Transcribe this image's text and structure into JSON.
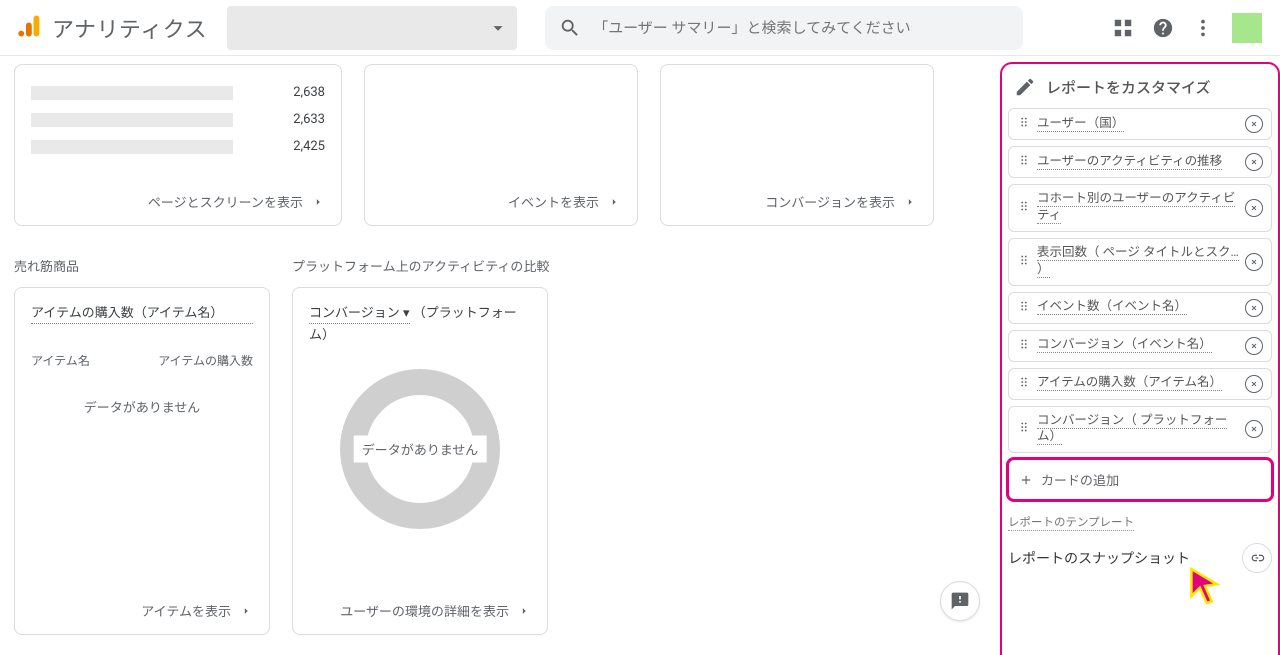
{
  "header": {
    "product": "アナリティクス",
    "search_placeholder": "「ユーザー サマリー」と検索してみてください"
  },
  "cards_row1": {
    "pages": {
      "values": [
        "2,638",
        "2,633",
        "2,425"
      ],
      "link": "ページとスクリーンを表示"
    },
    "events": {
      "link": "イベントを表示"
    },
    "conversions": {
      "link": "コンバージョンを表示"
    }
  },
  "section_left": {
    "title": "売れ筋商品",
    "metric": "アイテムの購入数（アイテム名）",
    "col_a": "アイテム名",
    "col_b": "アイテムの購入数",
    "nodata": "データがありません",
    "link": "アイテムを表示"
  },
  "section_right": {
    "title": "プラットフォーム上のアクティビティの比較",
    "metric_a": "コンバージョン",
    "metric_b": "（プラットフォーム）",
    "nodata": "データがありません",
    "link": "ユーザーの環境の詳細を表示"
  },
  "customize": {
    "title": "レポートをカスタマイズ",
    "items": [
      "ユーザー（国）",
      "ユーザーのアクティビティの推移",
      "コホート別のユーザーのアクティビティ",
      "表示回数（\nページ タイトルとスク… ）",
      "イベント数（イベント名）",
      "コンバージョン（イベント名）",
      "アイテムの購入数（アイテム名）",
      "コンバージョン（\nプラットフォーム）"
    ],
    "add": "カードの追加",
    "template": "レポートのテンプレート",
    "snapshot": "レポートのスナップショット"
  }
}
